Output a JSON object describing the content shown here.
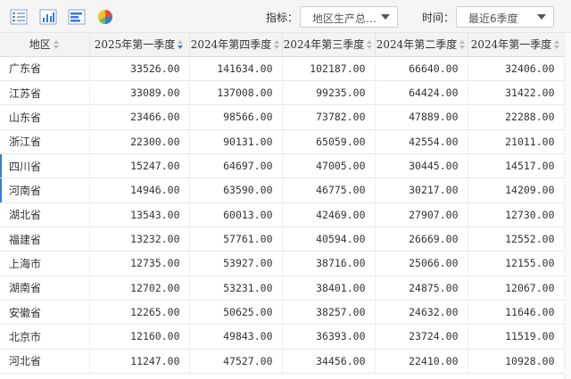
{
  "toolbar": {
    "icons": [
      "table-icon",
      "bar-chart-icon",
      "horizontal-bar-chart-icon",
      "pie-chart-icon"
    ],
    "indicator_label": "指标：",
    "indicator_value": "地区生产总…",
    "time_label": "时间：",
    "time_value": "最近6季度"
  },
  "table": {
    "headers": [
      "地区",
      "2025年第一季度",
      "2024年第四季度",
      "2024年第三季度",
      "2024年第二季度",
      "2024年第一季度"
    ],
    "active_sort_column": "2025年第一季度",
    "rows": [
      [
        "广东省",
        "33526.00",
        "141634.00",
        "102187.00",
        "66640.00",
        "32406.00"
      ],
      [
        "江苏省",
        "33089.00",
        "137008.00",
        "99235.00",
        "64424.00",
        "31422.00"
      ],
      [
        "山东省",
        "23466.00",
        "98566.00",
        "73782.00",
        "47889.00",
        "22288.00"
      ],
      [
        "浙江省",
        "22300.00",
        "90131.00",
        "65059.00",
        "42554.00",
        "21011.00"
      ],
      [
        "四川省",
        "15247.00",
        "64697.00",
        "47005.00",
        "30445.00",
        "14517.00"
      ],
      [
        "河南省",
        "14946.00",
        "63590.00",
        "46775.00",
        "30217.00",
        "14209.00"
      ],
      [
        "湖北省",
        "13543.00",
        "60013.00",
        "42469.00",
        "27907.00",
        "12730.00"
      ],
      [
        "福建省",
        "13232.00",
        "57761.00",
        "40594.00",
        "26669.00",
        "12552.00"
      ],
      [
        "上海市",
        "12735.00",
        "53927.00",
        "38716.00",
        "25066.00",
        "12155.00"
      ],
      [
        "湖南省",
        "12702.00",
        "53231.00",
        "38401.00",
        "24875.00",
        "12067.00"
      ],
      [
        "安徽省",
        "12265.00",
        "50625.00",
        "38257.00",
        "24632.00",
        "11646.00"
      ],
      [
        "北京市",
        "12160.00",
        "49843.00",
        "36393.00",
        "23724.00",
        "11519.00"
      ],
      [
        "河北省",
        "11247.00",
        "47527.00",
        "34456.00",
        "22410.00",
        "10928.00"
      ]
    ]
  },
  "colors": {
    "accent": "#3a7bd5",
    "header_bg": "#f3f3f3",
    "toolbar_bg": "#f5f5f5"
  }
}
